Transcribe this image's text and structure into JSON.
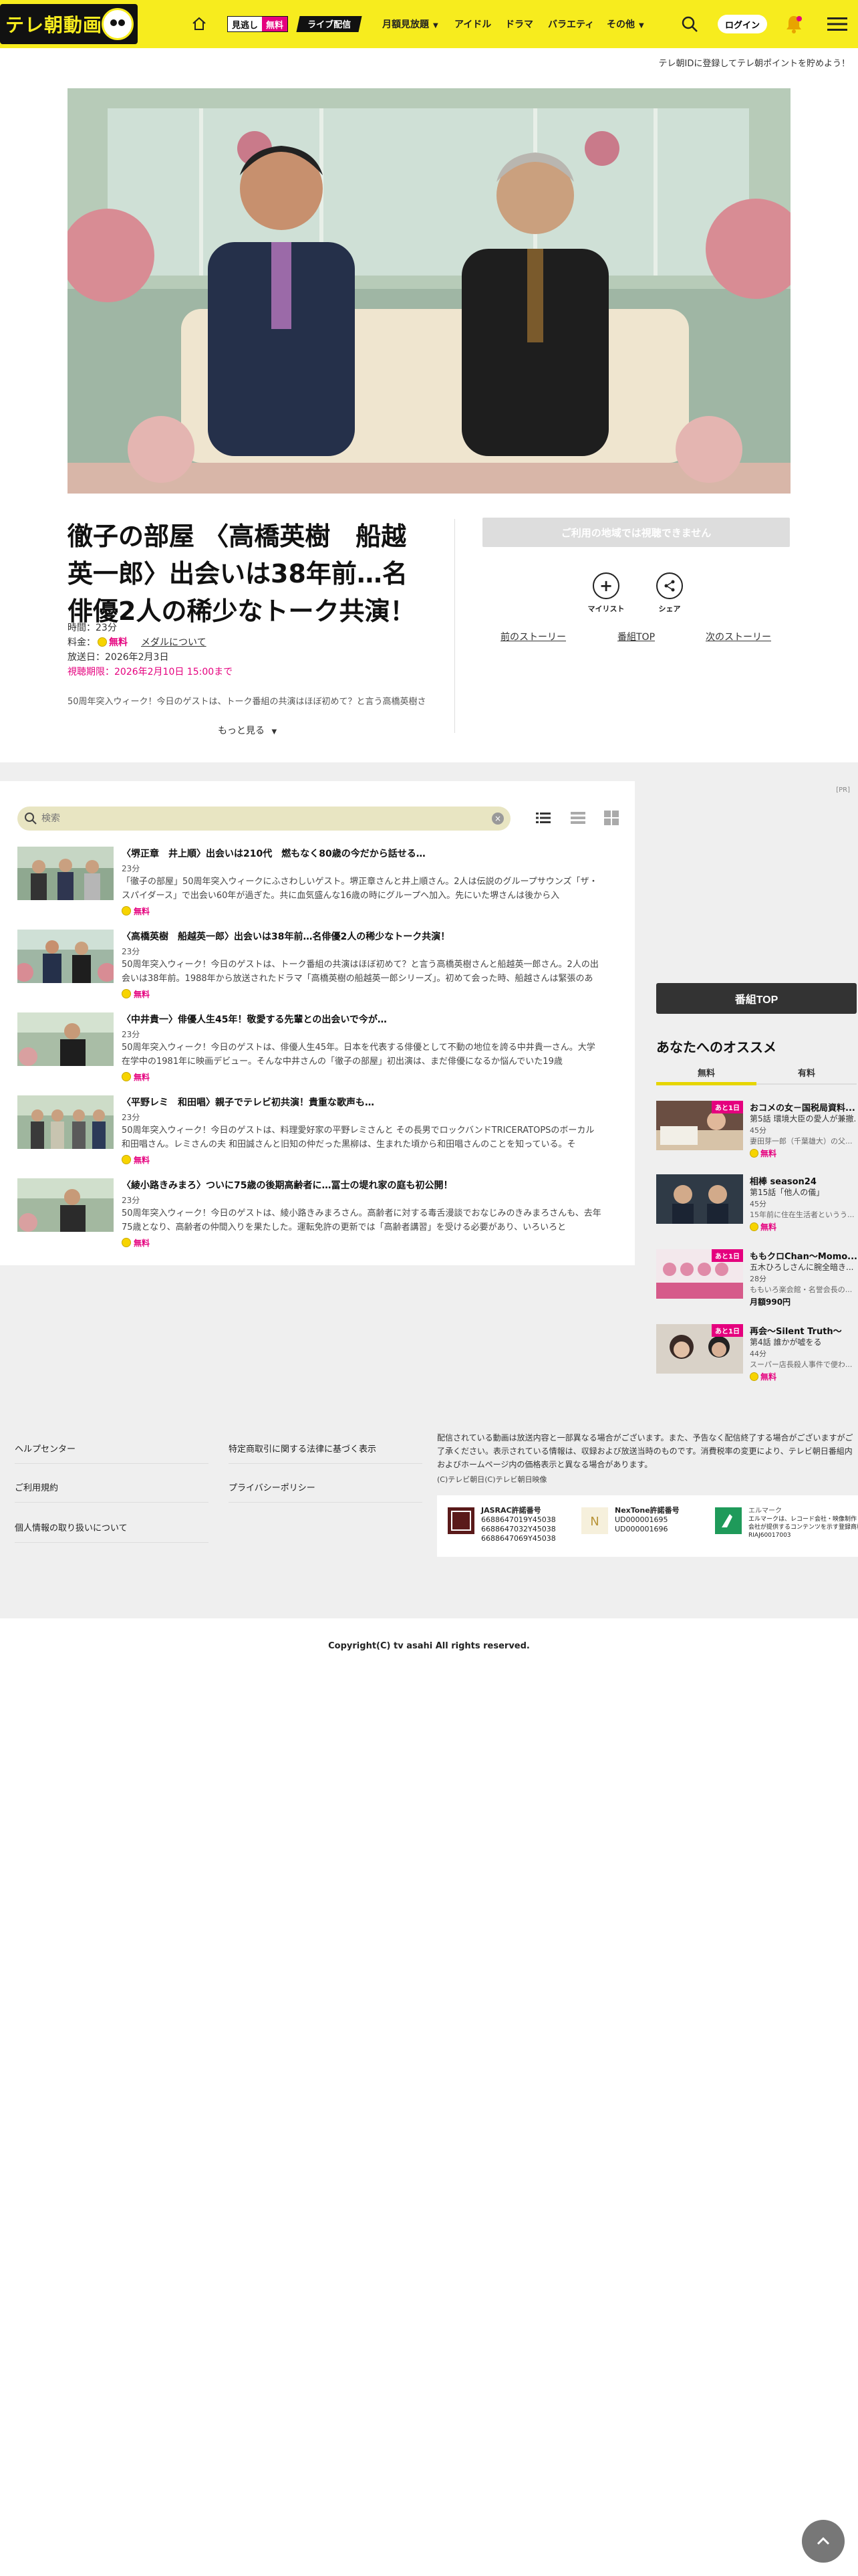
{
  "header": {
    "logo_text": "テレ朝動画",
    "mitotarashi_a": "見逃し",
    "mitotarashi_b": "無料",
    "live": "ライブ配信",
    "nav": [
      "月額見放題",
      "アイドル",
      "ドラマ",
      "バラエティ",
      "その他"
    ],
    "login": "ログイン"
  },
  "promo_line": "テレ朝IDに登録してテレ朝ポイントを貯めよう！",
  "program": {
    "title": "徹子の部屋 〈高橋英樹　船越英一郎〉出会いは38年前…名俳優2人の稀少なトーク共演！",
    "duration": "時間：23分",
    "price_label": "料金：",
    "price_free": "無料",
    "medal_link": "メダルについて",
    "air_date": "放送日：2026年2月3日",
    "deadline": "視聴期限：2026年2月10日 15:00まで",
    "description": "50周年突入ウィーク！今日のゲストは、トーク番組の共演はほぼ初めて？と言う高橋英樹さ",
    "more": "もっと見る",
    "no_watch": "ご利用の地域では視聴できません",
    "mylist": "マイリスト",
    "share": "シェア",
    "prev_story": "前のストーリー",
    "program_top": "番組TOP",
    "next_story": "次のストーリー"
  },
  "list": {
    "ad_mark": "[PR]",
    "search_placeholder": "検索",
    "episodes": [
      {
        "title": "〈堺正章　井上順〉出会いは210代　燃もなく80歳の今だから話せる…",
        "duration": "23分",
        "desc": "「徹子の部屋」50周年突入ウィークにふさわしいゲスト。堺正章さんと井上順さん。2人は伝説のグループサウンズ「ザ・スパイダース」で出会い60年が過ぎた。共に血気盛んな16歳の時にグループへ加入。先にいた堺さんは後から入",
        "free": "無料"
      },
      {
        "title": "〈高橋英樹　船越英一郎〉出会いは38年前…名俳優2人の稀少なトーク共演！",
        "duration": "23分",
        "desc": "50周年突入ウィーク！今日のゲストは、トーク番組の共演はほぼ初めて？と言う高橋英樹さんと船越英一郎さん。2人の出会いは38年前。1988年から放送されたドラマ「高橋英樹の船越英一郎シリーズ」。初めて会った時、船越さんは緊張のあ",
        "free": "無料"
      },
      {
        "title": "〈中井貴一〉俳優人生45年！敬愛する先輩との出会いで今が…",
        "duration": "23分",
        "desc": "50周年突入ウィーク！今日のゲストは、俳優人生45年。日本を代表する俳優として不動の地位を誇る中井貴一さん。大学在学中の1981年に映画デビュー。そんな中井さんの「徹子の部屋」初出演は、まだ俳優になるか悩んでいた19歳",
        "free": "無料"
      },
      {
        "title": "〈平野レミ　和田唱〉親子でテレビ初共演！貴重な歌声も…",
        "duration": "23分",
        "desc": "50周年突入ウィーク！今日のゲストは、料理愛好家の平野レミさんと その長男でロックバンドTRICERATOPSのボーカル 和田唱さん。レミさんの夫 和田誠さんと旧知の仲だった黒柳は、生まれた頃から和田唱さんのことを知っている。そ",
        "free": "無料"
      },
      {
        "title": "〈綾小路きみまろ〉ついに75歳の後期高齢者に…冨士の堤れ家の庭も初公開！",
        "duration": "23分",
        "desc": "50周年突入ウィーク！今日のゲストは、綾小路きみまろさん。高齢者に対する毒舌漫談でおなじみのきみまろさんも、去年75歳となり、高齢者の仲間入りを果たした。運転免許の更新では「高齢者講習」を受ける必要があり、いろいろと",
        "free": "無料"
      }
    ]
  },
  "sidebar": {
    "top_button": "番組TOP",
    "recommend_heading": "あなたへのオススメ",
    "tab_free": "無料",
    "tab_paid": "有料",
    "items": [
      {
        "tag": "あと1日",
        "title": "おコメの女－国税局資料...",
        "sub": "第5話 環境大臣の愛人が兼撤...",
        "duration": "45分",
        "desc": "妻田芽一郎（千葉雄大）の父...",
        "price": "無料"
      },
      {
        "tag": "",
        "title": "相棒 season24",
        "sub": "第15話「他人の儀」",
        "duration": "45分",
        "desc": "15年前に住在生活者というう...",
        "price": "無料"
      },
      {
        "tag": "あと1日",
        "title": "ももクロChan～Momo...",
        "sub": "五木ひろしさんに腕全暗き...",
        "duration": "28分",
        "desc": "ももいろ楽会館・名誉会長の...",
        "price": "月額990円"
      },
      {
        "tag": "あと1日",
        "title": "再会～Silent Truth～",
        "sub": "第4話 誰かが嘘をる",
        "duration": "44分",
        "desc": "スーパー店長殺人事件で便わ...",
        "price": "無料"
      }
    ]
  },
  "footer": {
    "links_left": [
      "ヘルプセンター",
      "ご利用規約",
      "個人情報の取り扱いについて"
    ],
    "links_right": [
      "特定商取引に関する法律に基づく表示",
      "プライバシーポリシー"
    ],
    "note": "配信されている動画は放送内容と一部異なる場合がございます。また、予告なく配信終了する場合がございますがご了承ください。表示されている情報は、収録および放送当時のものです。消費税率の変更により、テレビ朝日番組内およびホームページ内の価格表示と異なる場合があります。",
    "copy_small": "(C)テレビ朝日(C)テレビ朝日映像",
    "licenses": [
      {
        "name": "JASRAC許諾番号",
        "num": "6688647019Y45038\n6688647032Y45038\n6688647069Y45038"
      },
      {
        "name": "NexTone許諾番号",
        "num": "UD000001695\nUD000001696"
      },
      {
        "name": "エルマーク",
        "num": "エルマークは、レコード会社・映像制作\n会社が提供するコンテンツを示す登録商標です\nRIAJ60017003"
      }
    ],
    "copyright": "Copyright(C) tv asahi All rights reserved."
  },
  "colors": {
    "brand_yellow": "#f7ec1e",
    "accent_pink": "#e5007e"
  }
}
